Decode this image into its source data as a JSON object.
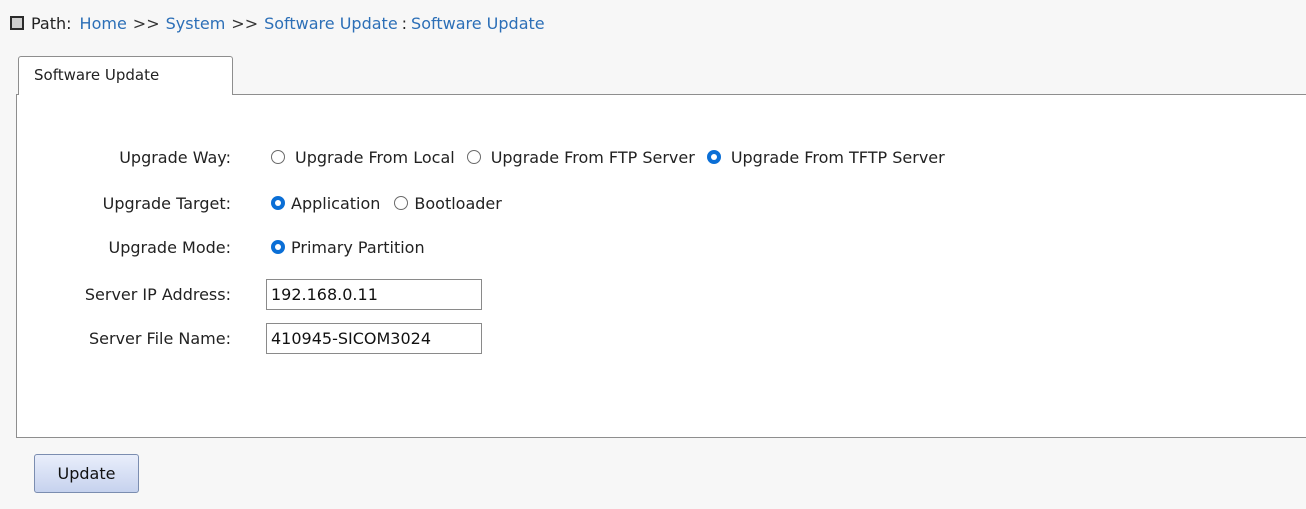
{
  "breadcrumb": {
    "prefix": "Path:",
    "items": [
      "Home",
      "System",
      "Software Update"
    ],
    "separator": ">>",
    "current_sep": ":",
    "current": "Software Update"
  },
  "tab": {
    "label": "Software Update"
  },
  "form": {
    "upgrade_way": {
      "label": "Upgrade Way:",
      "options": [
        {
          "label": "Upgrade From Local",
          "checked": false
        },
        {
          "label": "Upgrade From FTP Server",
          "checked": false
        },
        {
          "label": "Upgrade From TFTP Server",
          "checked": true
        }
      ]
    },
    "upgrade_target": {
      "label": "Upgrade Target:",
      "options": [
        {
          "label": "Application",
          "checked": true
        },
        {
          "label": "Bootloader",
          "checked": false
        }
      ]
    },
    "upgrade_mode": {
      "label": "Upgrade Mode:",
      "options": [
        {
          "label": "Primary Partition",
          "checked": true
        }
      ]
    },
    "server_ip": {
      "label": "Server IP Address:",
      "value": "192.168.0.11"
    },
    "server_file": {
      "label": "Server File Name:",
      "value": "410945-SICOM3024"
    }
  },
  "buttons": {
    "update_label": "Update"
  },
  "colors": {
    "link": "#2c6fb7",
    "radio_checked": "#0b6fd6"
  }
}
